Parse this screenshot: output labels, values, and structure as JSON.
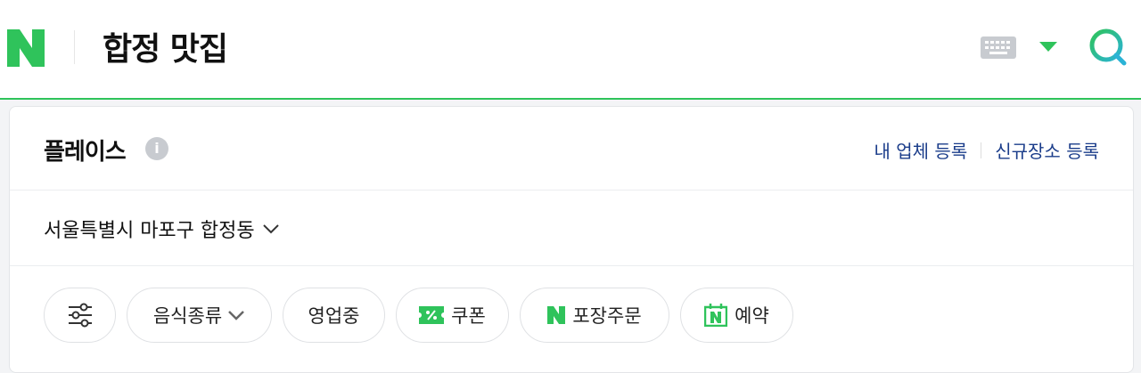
{
  "header": {
    "query": "합정 맛집",
    "logo_icon": "naver-n-logo",
    "keyboard_icon": "keyboard-icon",
    "search_icon": "search-icon",
    "brand_color": "#2fc35b"
  },
  "place": {
    "title": "플레이스",
    "info_label": "i",
    "link_my_business": "내 업체 등록",
    "link_new_place": "신규장소 등록",
    "location": "서울특별시 마포구 합정동",
    "filters": [
      {
        "label": "",
        "icon": "filter-sliders-icon"
      },
      {
        "label": "음식종류",
        "icon": "chevron-down-icon"
      },
      {
        "label": "영업중",
        "icon": ""
      },
      {
        "label": "쿠폰",
        "icon": "coupon-icon"
      },
      {
        "label": "포장주문",
        "icon": "naver-n-icon"
      },
      {
        "label": "예약",
        "icon": "booking-calendar-icon"
      }
    ]
  }
}
